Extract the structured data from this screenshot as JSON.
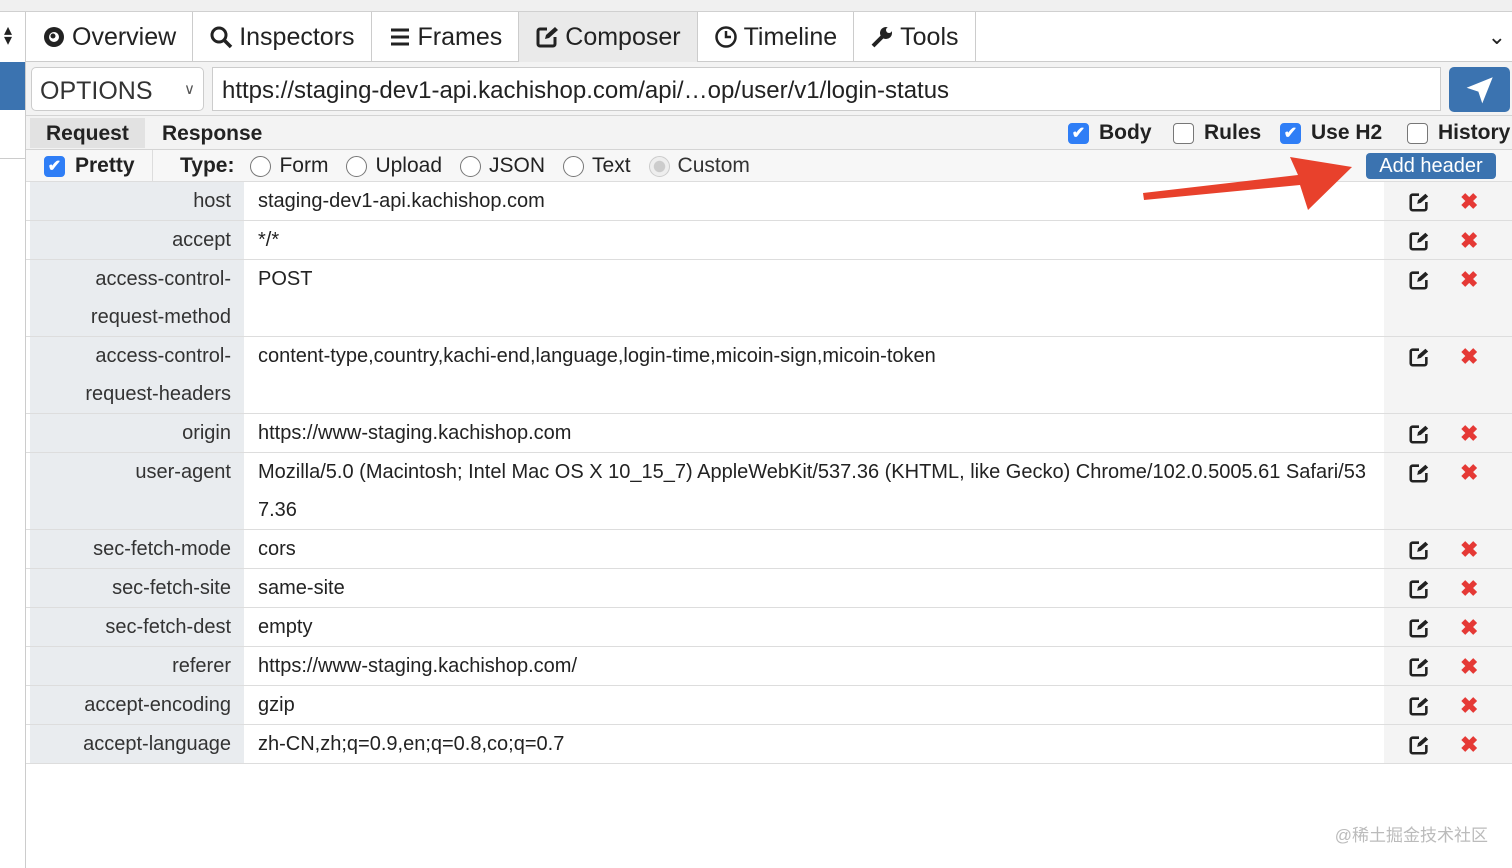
{
  "tabs": [
    {
      "label": "Overview",
      "icon": "eye-icon"
    },
    {
      "label": "Inspectors",
      "icon": "search-icon"
    },
    {
      "label": "Frames",
      "icon": "menu-icon"
    },
    {
      "label": "Composer",
      "icon": "edit-icon",
      "active": true
    },
    {
      "label": "Timeline",
      "icon": "clock-icon"
    },
    {
      "label": "Tools",
      "icon": "wrench-icon"
    }
  ],
  "request": {
    "method": "OPTIONS",
    "url": "https://staging-dev1-api.kachishop.com/api/…op/user/v1/login-status"
  },
  "options": {
    "request_tab": "Request",
    "response_tab": "Response",
    "body": "Body",
    "rules": "Rules",
    "use_h2": "Use H2",
    "history": "History",
    "body_checked": true,
    "rules_checked": false,
    "use_h2_checked": true,
    "history_checked": false
  },
  "typebar": {
    "pretty": "Pretty",
    "pretty_checked": true,
    "type_label": "Type:",
    "types": [
      "Form",
      "Upload",
      "JSON",
      "Text",
      "Custom"
    ],
    "selected": "Custom",
    "add_header": "Add header"
  },
  "headers": [
    {
      "key": "host",
      "value": "staging-dev1-api.kachishop.com"
    },
    {
      "key": "accept",
      "value": "*/*"
    },
    {
      "key": "access-control-request-method",
      "value": "POST"
    },
    {
      "key": "access-control-request-headers",
      "value": "content-type,country,kachi-end,language,login-time,micoin-sign,micoin-token"
    },
    {
      "key": "origin",
      "value": "https://www-staging.kachishop.com"
    },
    {
      "key": "user-agent",
      "value": "Mozilla/5.0 (Macintosh; Intel Mac OS X 10_15_7) AppleWebKit/537.36 (KHTML, like Gecko) Chrome/102.0.5005.61 Safari/537.36"
    },
    {
      "key": "sec-fetch-mode",
      "value": "cors"
    },
    {
      "key": "sec-fetch-site",
      "value": "same-site"
    },
    {
      "key": "sec-fetch-dest",
      "value": "empty"
    },
    {
      "key": "referer",
      "value": "https://www-staging.kachishop.com/"
    },
    {
      "key": "accept-encoding",
      "value": "gzip"
    },
    {
      "key": "accept-language",
      "value": "zh-CN,zh;q=0.9,en;q=0.8,co;q=0.7"
    }
  ],
  "colors": {
    "accent": "#3b73b0",
    "checkbox": "#2f7ef6",
    "delete": "#e53935",
    "annotation_arrow": "#e8412c"
  },
  "watermark": "@稀土掘金技术社区"
}
